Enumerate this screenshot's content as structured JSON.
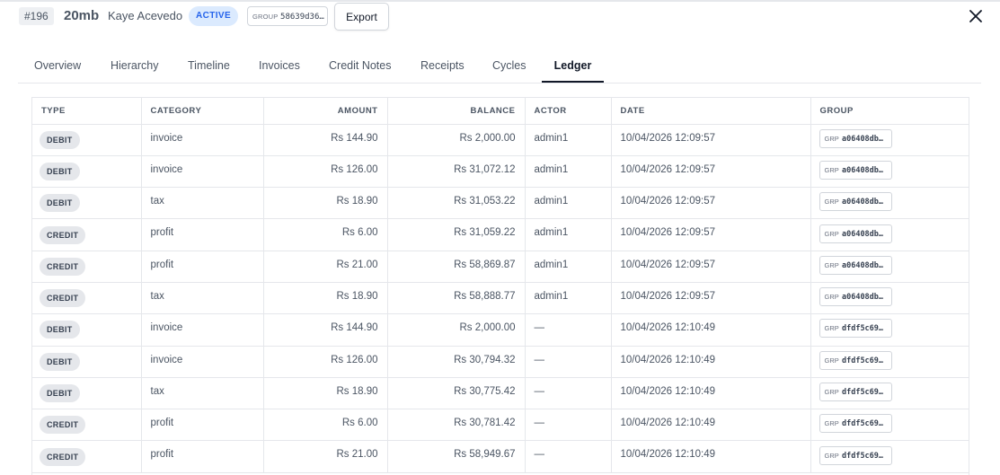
{
  "header": {
    "id": "#196",
    "plan": "20mb",
    "customer": "Kaye Acevedo",
    "status": "ACTIVE",
    "group_label": "GROUP",
    "group_value": "58639d36…",
    "export_label": "Export",
    "close_icon": "close-icon"
  },
  "tabs": [
    {
      "label": "Overview"
    },
    {
      "label": "Hierarchy"
    },
    {
      "label": "Timeline"
    },
    {
      "label": "Invoices"
    },
    {
      "label": "Credit Notes"
    },
    {
      "label": "Receipts"
    },
    {
      "label": "Cycles"
    },
    {
      "label": "Ledger",
      "active": true
    }
  ],
  "ledger": {
    "columns": [
      "TYPE",
      "CATEGORY",
      "AMOUNT",
      "BALANCE",
      "ACTOR",
      "DATE",
      "GROUP"
    ],
    "rows": [
      {
        "type": "DEBIT",
        "category": "invoice",
        "amount": "Rs 144.90",
        "balance": "Rs 2,000.00",
        "actor": "admin1",
        "date": "10/04/2026 12:09:57",
        "grp_label": "GRP",
        "group": "a06408db…"
      },
      {
        "type": "DEBIT",
        "category": "invoice",
        "amount": "Rs 126.00",
        "balance": "Rs 31,072.12",
        "actor": "admin1",
        "date": "10/04/2026 12:09:57",
        "grp_label": "GRP",
        "group": "a06408db…"
      },
      {
        "type": "DEBIT",
        "category": "tax",
        "amount": "Rs 18.90",
        "balance": "Rs 31,053.22",
        "actor": "admin1",
        "date": "10/04/2026 12:09:57",
        "grp_label": "GRP",
        "group": "a06408db…"
      },
      {
        "type": "CREDIT",
        "category": "profit",
        "amount": "Rs 6.00",
        "balance": "Rs 31,059.22",
        "actor": "admin1",
        "date": "10/04/2026 12:09:57",
        "grp_label": "GRP",
        "group": "a06408db…"
      },
      {
        "type": "CREDIT",
        "category": "profit",
        "amount": "Rs 21.00",
        "balance": "Rs 58,869.87",
        "actor": "admin1",
        "date": "10/04/2026 12:09:57",
        "grp_label": "GRP",
        "group": "a06408db…"
      },
      {
        "type": "CREDIT",
        "category": "tax",
        "amount": "Rs 18.90",
        "balance": "Rs 58,888.77",
        "actor": "admin1",
        "date": "10/04/2026 12:09:57",
        "grp_label": "GRP",
        "group": "a06408db…"
      },
      {
        "type": "DEBIT",
        "category": "invoice",
        "amount": "Rs 144.90",
        "balance": "Rs 2,000.00",
        "actor": "—",
        "date": "10/04/2026 12:10:49",
        "grp_label": "GRP",
        "group": "dfdf5c69…"
      },
      {
        "type": "DEBIT",
        "category": "invoice",
        "amount": "Rs 126.00",
        "balance": "Rs 30,794.32",
        "actor": "—",
        "date": "10/04/2026 12:10:49",
        "grp_label": "GRP",
        "group": "dfdf5c69…"
      },
      {
        "type": "DEBIT",
        "category": "tax",
        "amount": "Rs 18.90",
        "balance": "Rs 30,775.42",
        "actor": "—",
        "date": "10/04/2026 12:10:49",
        "grp_label": "GRP",
        "group": "dfdf5c69…"
      },
      {
        "type": "CREDIT",
        "category": "profit",
        "amount": "Rs 6.00",
        "balance": "Rs 30,781.42",
        "actor": "—",
        "date": "10/04/2026 12:10:49",
        "grp_label": "GRP",
        "group": "dfdf5c69…"
      },
      {
        "type": "CREDIT",
        "category": "profit",
        "amount": "Rs 21.00",
        "balance": "Rs 58,949.67",
        "actor": "—",
        "date": "10/04/2026 12:10:49",
        "grp_label": "GRP",
        "group": "dfdf5c69…"
      }
    ]
  }
}
